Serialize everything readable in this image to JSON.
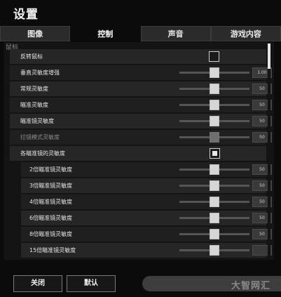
{
  "window": {
    "title": "设置"
  },
  "tabs": [
    {
      "label": "图像",
      "active": false
    },
    {
      "label": "控制",
      "active": true
    },
    {
      "label": "声音",
      "active": false
    },
    {
      "label": "游戏内容",
      "active": false
    }
  ],
  "section": {
    "label": "鼠标"
  },
  "rows": [
    {
      "label": "反转鼠标",
      "kind": "checkbox",
      "checked": false,
      "indent": 0
    },
    {
      "label": "垂直灵敏度增强",
      "kind": "slider",
      "level": 0.5,
      "value": "1.00",
      "indent": 0
    },
    {
      "label": "常规灵敏度",
      "kind": "slider",
      "level": 0.5,
      "value": "50",
      "indent": 0
    },
    {
      "label": "瞄准灵敏度",
      "kind": "slider",
      "level": 0.5,
      "value": "50",
      "indent": 0
    },
    {
      "label": "瞄准镜灵敏度",
      "kind": "slider",
      "level": 0.5,
      "value": "50",
      "indent": 0
    },
    {
      "label": "拉镜模式灵敏度",
      "kind": "slider",
      "level": 0.5,
      "value": "50",
      "indent": 0,
      "disabled": true
    },
    {
      "label": "各瞄准镜的灵敏度",
      "kind": "checkbox",
      "checked": true,
      "indent": 0
    },
    {
      "label": "2倍瞄准镜灵敏度",
      "kind": "slider",
      "level": 0.5,
      "value": "50",
      "indent": 1
    },
    {
      "label": "3倍瞄准镜灵敏度",
      "kind": "slider",
      "level": 0.5,
      "value": "50",
      "indent": 1
    },
    {
      "label": "4倍瞄准镜灵敏度",
      "kind": "slider",
      "level": 0.5,
      "value": "50",
      "indent": 1
    },
    {
      "label": "6倍瞄准镜灵敏度",
      "kind": "slider",
      "level": 0.5,
      "value": "50",
      "indent": 1
    },
    {
      "label": "8倍瞄准镜灵敏度",
      "kind": "slider",
      "level": 0.5,
      "value": "50",
      "indent": 1
    },
    {
      "label": "15倍瞄准镜灵敏度",
      "kind": "slider",
      "level": 0.5,
      "value": "",
      "indent": 1
    }
  ],
  "footer": {
    "close_label": "关闭",
    "default_label": "默认"
  },
  "watermark": "大智网汇",
  "colors": {
    "background": "#0b0b0b",
    "row": "#262626",
    "thumb": "#d6d6d6"
  }
}
